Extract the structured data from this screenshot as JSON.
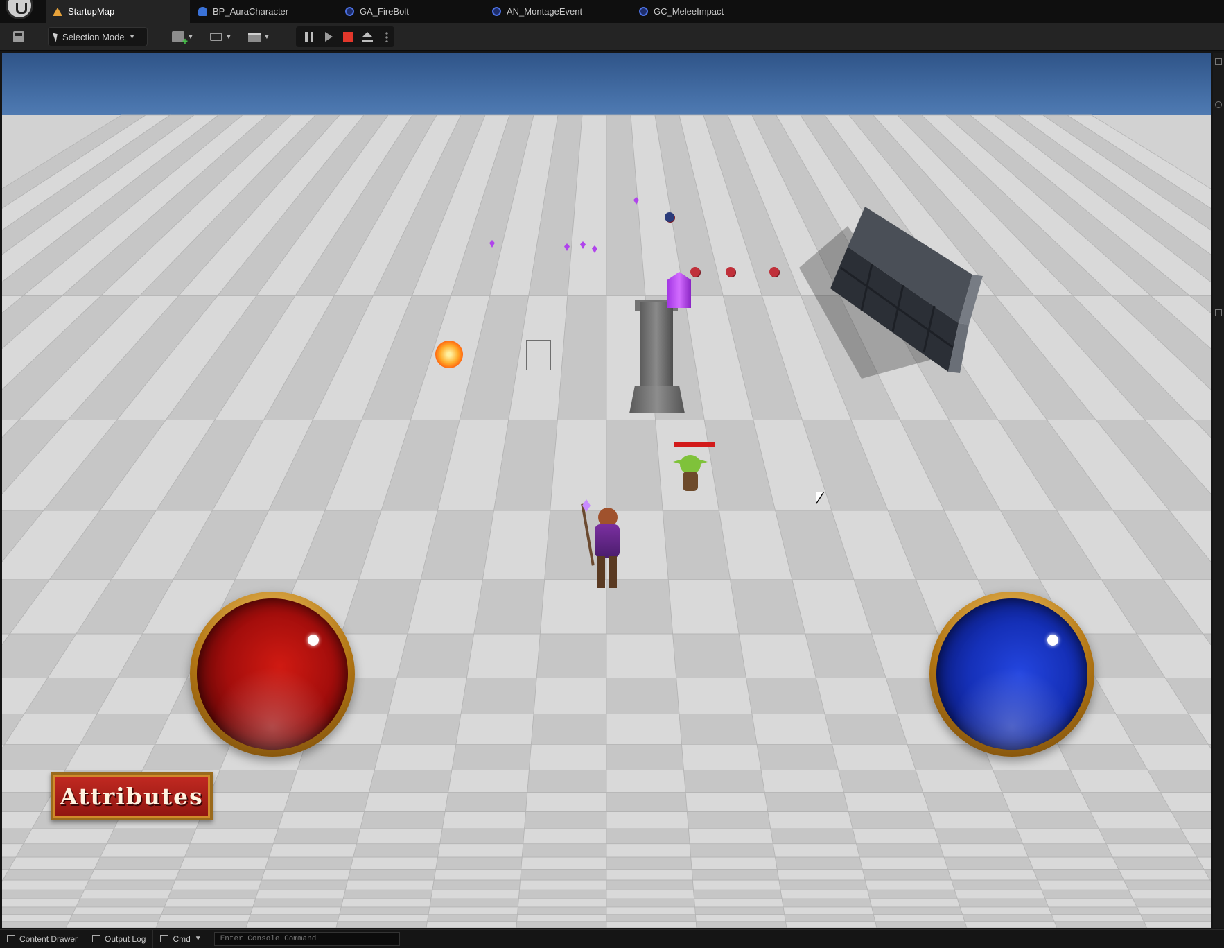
{
  "tabs": [
    {
      "label": "StartupMap",
      "icon": "map-icon",
      "active": true
    },
    {
      "label": "BP_AuraCharacter",
      "icon": "blueprint-character-icon",
      "active": false
    },
    {
      "label": "GA_FireBolt",
      "icon": "asset-icon",
      "active": false
    },
    {
      "label": "AN_MontageEvent",
      "icon": "asset-icon",
      "active": false
    },
    {
      "label": "GC_MeleeImpact",
      "icon": "asset-icon",
      "active": false
    }
  ],
  "toolbar": {
    "selection_mode": "Selection Mode",
    "play_controls": [
      "pause-icon",
      "step-icon",
      "stop-icon",
      "eject-icon",
      "more-icon"
    ]
  },
  "hud": {
    "attributes_label": "Attributes",
    "health_globe_color": "#b01510",
    "mana_globe_color": "#1a36c8",
    "enemy_health_color": "#d21a1a"
  },
  "statusbar": {
    "content_drawer": "Content Drawer",
    "output_log": "Output Log",
    "cmd": "Cmd",
    "console_placeholder": "Enter Console Command"
  },
  "colors": {
    "editor_bg": "#242424",
    "tab_bar_bg": "#0f0f0f",
    "stop_red": "#e2372b",
    "sky_blue": "#3e6aa2"
  }
}
